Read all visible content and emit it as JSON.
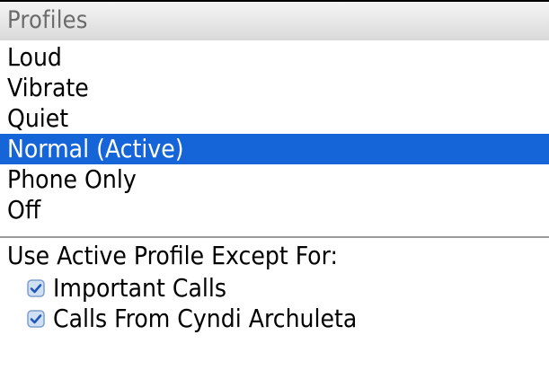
{
  "header": {
    "title": "Profiles"
  },
  "profiles": [
    {
      "label": "Loud",
      "selected": false
    },
    {
      "label": "Vibrate",
      "selected": false
    },
    {
      "label": "Quiet",
      "selected": false
    },
    {
      "label": "Normal (Active)",
      "selected": true
    },
    {
      "label": "Phone Only",
      "selected": false
    },
    {
      "label": "Off",
      "selected": false
    }
  ],
  "exceptions": {
    "heading": "Use Active Profile Except For:",
    "items": [
      {
        "label": "Important Calls",
        "checked": true,
        "icon": "checkbox-checked-icon"
      },
      {
        "label": "Calls From Cyndi Archuleta",
        "checked": true,
        "icon": "checkbox-checked-icon"
      }
    ]
  },
  "colors": {
    "selection": "#1565d8",
    "title_text": "#6b6b6b",
    "checkbox_fill": "#cfe0f5",
    "checkbox_check": "#1e57b8"
  }
}
